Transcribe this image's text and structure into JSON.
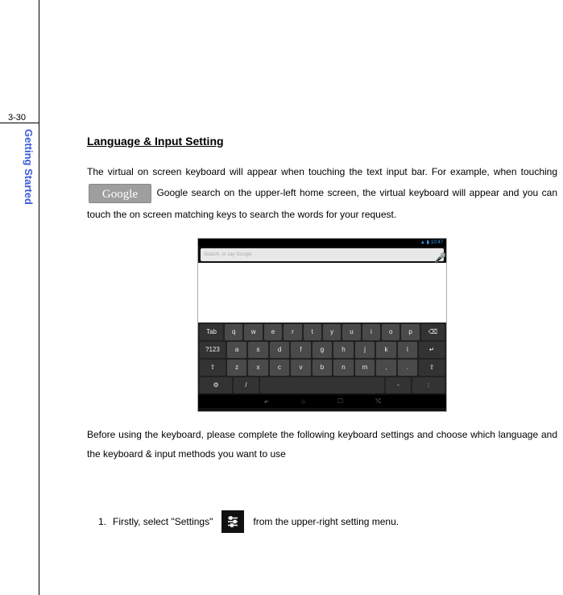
{
  "page_number": "3-30",
  "side_label": "Getting Started",
  "heading": "Language & Input Setting",
  "paragraph1_a": "The virtual on screen keyboard will appear when touching the text input bar. For example, when touching ",
  "google_label": "Google",
  "paragraph1_b": " Google search on the upper-left home screen, the virtual keyboard will appear and you can touch the on screen matching keys to search the words for your request.",
  "paragraph2": "Before using the keyboard, please complete the following keyboard settings and choose which language and the keyboard & input methods you want to use",
  "list": {
    "num": "1.",
    "text_a": "Firstly, select \"Settings\" ",
    "text_b": " from the upper-right setting menu."
  },
  "keyboard": {
    "status_time": "10:47",
    "search_placeholder": "Search, or say Google",
    "row1": [
      "Tab",
      "q",
      "w",
      "e",
      "r",
      "t",
      "y",
      "u",
      "i",
      "o",
      "p",
      "⌫"
    ],
    "row2": [
      "?123",
      "a",
      "s",
      "d",
      "f",
      "g",
      "h",
      "j",
      "k",
      "l",
      "↵"
    ],
    "row3": [
      "⇧",
      "z",
      "x",
      "c",
      "v",
      "b",
      "n",
      "m",
      ",",
      ".",
      "⇧"
    ],
    "row4_left1": "⚙",
    "row4_left2": "/",
    "row4_right1": "-",
    "row4_right2": ":",
    "nav": [
      "⬐",
      "⌂",
      "☐",
      "⤭"
    ]
  }
}
